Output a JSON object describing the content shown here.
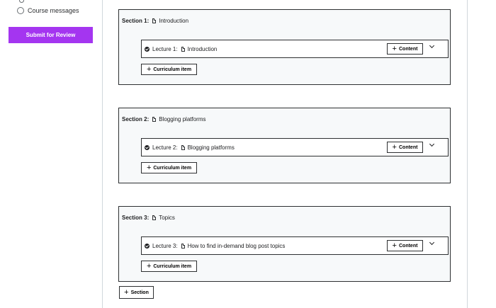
{
  "sidebar": {
    "nav_item_label": "Course messages",
    "submit_label": "Submit for Review"
  },
  "sections": [
    {
      "label": "Section 1:",
      "title": "Introduction",
      "lecture_label": "Lecture 1:",
      "lecture_title": "Introduction",
      "content_label": "Content",
      "curriculum_label": "Curriculum item"
    },
    {
      "label": "Section 2:",
      "title": "Blogging platforms",
      "lecture_label": "Lecture 2:",
      "lecture_title": "Blogging platforms",
      "content_label": "Content",
      "curriculum_label": "Curriculum item"
    },
    {
      "label": "Section 3:",
      "title": "Topics",
      "lecture_label": "Lecture 3:",
      "lecture_title": "How to find in-demand blog post topics",
      "content_label": "Content",
      "curriculum_label": "Curriculum item"
    }
  ],
  "add_section_label": "Section",
  "colors": {
    "accent": "#a435f0",
    "border": "#2d2f31",
    "section_bg": "#f7f9fa"
  }
}
